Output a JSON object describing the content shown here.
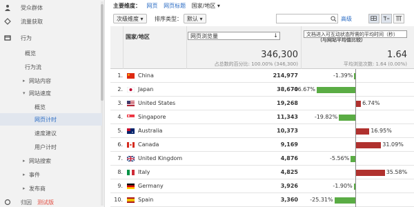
{
  "sidebar": {
    "items": [
      {
        "label": "受众群体",
        "icon": "person-icon",
        "level": 0
      },
      {
        "label": "流量获取",
        "icon": "acquisition-icon",
        "level": 0
      },
      {
        "label": "行为",
        "icon": "behavior-icon",
        "level": 0,
        "expanded": true
      },
      {
        "label": "概览",
        "level": 1
      },
      {
        "label": "行为流",
        "level": 1
      },
      {
        "label": "网站内容",
        "level": 1,
        "arrow": "right"
      },
      {
        "label": "网站速度",
        "level": 1,
        "arrow": "down"
      },
      {
        "label": "概览",
        "level": 2
      },
      {
        "label": "网页计时",
        "level": 2,
        "active": true
      },
      {
        "label": "速度建议",
        "level": 2
      },
      {
        "label": "用户计时",
        "level": 2
      },
      {
        "label": "网站搜索",
        "level": 1,
        "arrow": "right"
      },
      {
        "label": "事件",
        "level": 1,
        "arrow": "right"
      },
      {
        "label": "发布商",
        "level": 1,
        "arrow": "right"
      },
      {
        "label": "归因",
        "level": 0,
        "icon": "attribution-icon",
        "beta": "测试版"
      }
    ]
  },
  "toolbar": {
    "primary_dimension_label": "主要维度：",
    "dim_links": [
      "网页",
      "网页标题"
    ],
    "dim_current": "国家/地区",
    "secondary_dim": "次级维度",
    "sort_type_label": "排序类型：",
    "sort_type_value": "默认",
    "search_placeholder": "",
    "advanced": "高级"
  },
  "table": {
    "col_country": "国家/地区",
    "metric1_select": "网页浏览量",
    "metric2_select": "文档进入可互动状态所需的平均时间（秒）",
    "metric2_sub": "（与网站平均值比较）",
    "total_value": "346,300",
    "total_note": "占总数的百分比: 100.00% (346,300)",
    "avg_value": "1.64",
    "avg_note": "平均浏览次数: 1.64 (0.00%)",
    "rows": [
      {
        "rank": "1.",
        "country": "China",
        "flag": "cn",
        "views": "214,977",
        "pct": "-1.39%",
        "value": -1.39
      },
      {
        "rank": "2.",
        "country": "Japan",
        "flag": "jp",
        "views": "38,670",
        "pct": "-46.67%",
        "value": -46.67
      },
      {
        "rank": "3.",
        "country": "United States",
        "flag": "us",
        "views": "19,268",
        "pct": "6.74%",
        "value": 6.74
      },
      {
        "rank": "4.",
        "country": "Singapore",
        "flag": "sg",
        "views": "11,343",
        "pct": "-19.82%",
        "value": -19.82
      },
      {
        "rank": "5.",
        "country": "Australia",
        "flag": "au",
        "views": "10,373",
        "pct": "16.95%",
        "value": 16.95
      },
      {
        "rank": "6.",
        "country": "Canada",
        "flag": "ca",
        "views": "9,169",
        "pct": "31.09%",
        "value": 31.09
      },
      {
        "rank": "7.",
        "country": "United Kingdom",
        "flag": "gb",
        "views": "4,876",
        "pct": "-5.56%",
        "value": -5.56
      },
      {
        "rank": "8.",
        "country": "Italy",
        "flag": "it",
        "views": "4,825",
        "pct": "35.58%",
        "value": 35.58
      },
      {
        "rank": "9.",
        "country": "Germany",
        "flag": "de",
        "views": "3,926",
        "pct": "-1.90%",
        "value": -1.9
      },
      {
        "rank": "10.",
        "country": "Spain",
        "flag": "es",
        "views": "3,360",
        "pct": "-25.31%",
        "value": -25.31
      }
    ]
  },
  "colors": {
    "negative": "#5aac44",
    "positive": "#b0312e",
    "link": "#2b6cc4",
    "active_bg": "#e1e6ee"
  }
}
